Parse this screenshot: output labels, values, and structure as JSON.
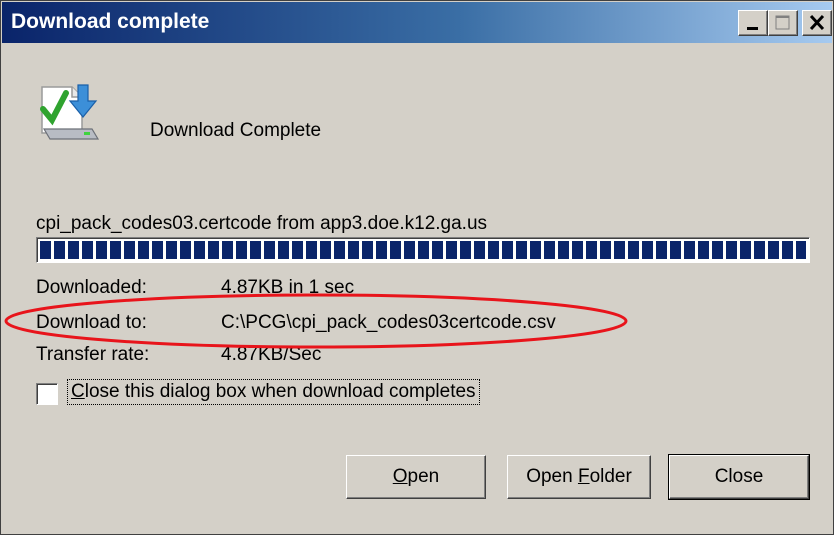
{
  "window": {
    "title": "Download complete",
    "accent_color": "#0a246a",
    "buttons": {
      "minimize_icon": "minimize-icon",
      "maximize_icon": "maximize-icon",
      "close_icon": "close-icon"
    }
  },
  "dialog": {
    "icon": "download-complete-icon",
    "heading": "Download Complete",
    "file_from": "cpi_pack_codes03.certcode from app3.doe.k12.ga.us",
    "progress_percent": 100,
    "details": [
      {
        "label": "Downloaded:",
        "value": "4.87KB in 1 sec"
      },
      {
        "label": "Download to:",
        "value": "C:\\PCG\\cpi_pack_codes03certcode.csv"
      },
      {
        "label": "Transfer rate:",
        "value": "4.87KB/Sec"
      }
    ],
    "close_checkbox": {
      "label_prefix": "C",
      "label_rest": "lose this dialog box when download completes",
      "checked": false
    },
    "actions": {
      "open_prefix": "O",
      "open_rest": "pen",
      "open_folder_prefix": "Open ",
      "open_folder_underline": "F",
      "open_folder_rest": "older",
      "close": "Close"
    },
    "annotation_color": "#e8141b"
  }
}
